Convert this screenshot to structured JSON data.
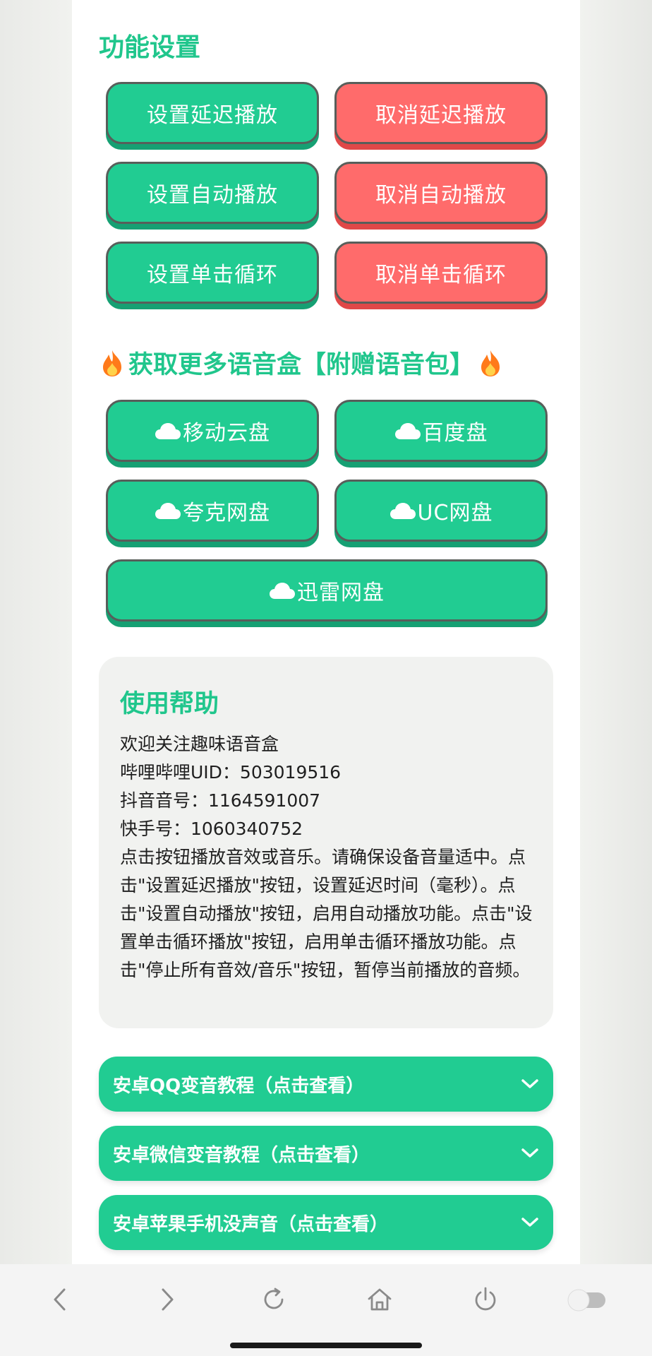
{
  "settings": {
    "title": "功能设置",
    "buttons": {
      "set_delay": "设置延迟播放",
      "cancel_delay": "取消延迟播放",
      "set_auto": "设置自动播放",
      "cancel_auto": "取消自动播放",
      "set_loop": "设置单击循环",
      "cancel_loop": "取消单击循环"
    }
  },
  "downloads": {
    "title": "获取更多语音盒【附赠语音包】",
    "links": {
      "mobile_cloud": "移动云盘",
      "baidu": "百度盘",
      "quark": "夸克网盘",
      "uc": "UC网盘",
      "xunlei": "迅雷网盘"
    }
  },
  "help": {
    "title": "使用帮助",
    "lines": [
      "欢迎关注趣味语音盒",
      "哔哩哔哩UID：503019516",
      "抖音音号：1164591007",
      "快手号：1060340752",
      "点击按钮播放音效或音乐。请确保设备音量适中。点击\"设置延迟播放\"按钮，设置延迟时间（毫秒）。点击\"设置自动播放\"按钮，启用自动播放功能。点击\"设置单击循环播放\"按钮，启用单击循环播放功能。点击\"停止所有音效/音乐\"按钮，暂停当前播放的音频。"
    ]
  },
  "accordions": [
    "安卓QQ变音教程（点击查看）",
    "安卓微信变音教程（点击查看）",
    "安卓苹果手机没声音（点击查看）"
  ],
  "colors": {
    "accent_green": "#21cc92",
    "danger_red": "#ff6b6b",
    "title_green": "#20c68c"
  },
  "nav_icons": [
    "back-icon",
    "forward-icon",
    "reload-icon",
    "home-icon",
    "power-icon",
    "toggle-icon"
  ]
}
